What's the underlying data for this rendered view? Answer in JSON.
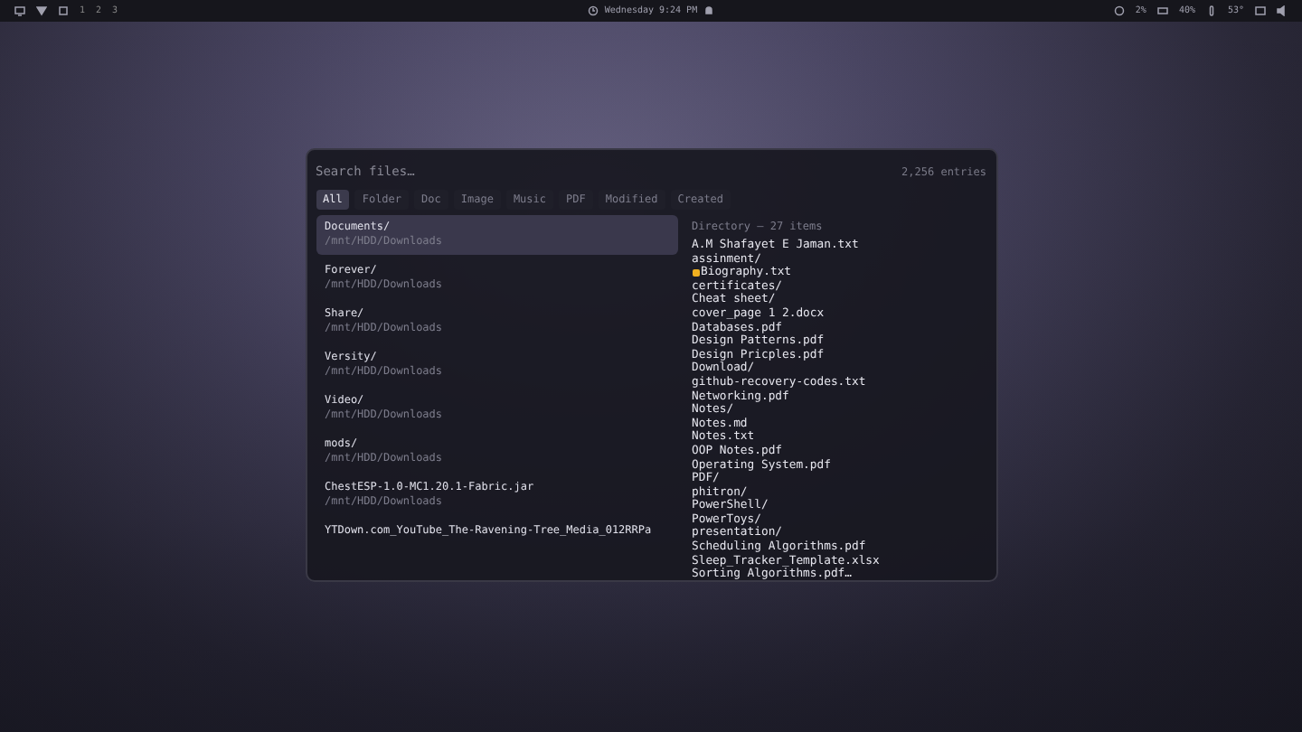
{
  "top_bar": {
    "workspaces": [
      {
        "label": "1",
        "selected": false
      },
      {
        "label": "2",
        "selected": false
      },
      {
        "label": "3",
        "selected": false
      }
    ],
    "clock": "Wednesday 9:24 PM",
    "status": [
      {
        "kind": "cpu",
        "text": "2%"
      },
      {
        "kind": "memory",
        "text": "40%"
      },
      {
        "kind": "temperature",
        "text": "53°"
      }
    ]
  },
  "launcher": {
    "search": {
      "placeholder": "Search files…"
    },
    "count": "2,256 entries",
    "filters": [
      {
        "label": "All",
        "selected": true
      },
      {
        "label": "Folder",
        "selected": false
      },
      {
        "label": "Doc",
        "selected": false
      },
      {
        "label": "Image",
        "selected": false
      },
      {
        "label": "Music",
        "selected": false
      },
      {
        "label": "PDF",
        "selected": false
      },
      {
        "label": "Modified",
        "selected": false
      },
      {
        "label": "Created",
        "selected": false
      }
    ],
    "results": [
      {
        "name": "Documents/",
        "path": "/mnt/HDD/Downloads",
        "selected": true
      },
      {
        "name": "Forever/",
        "path": "/mnt/HDD/Downloads",
        "selected": false
      },
      {
        "name": "Share/",
        "path": "/mnt/HDD/Downloads",
        "selected": false
      },
      {
        "name": "Versity/",
        "path": "/mnt/HDD/Downloads",
        "selected": false
      },
      {
        "name": "Video/",
        "path": "/mnt/HDD/Downloads",
        "selected": false
      },
      {
        "name": "mods/",
        "path": "/mnt/HDD/Downloads",
        "selected": false
      },
      {
        "name": "ChestESP-1.0-MC1.20.1-Fabric.jar",
        "path": "/mnt/HDD/Downloads",
        "selected": false
      },
      {
        "name": "YTDown.com_YouTube_The-Ravening-Tree_Media_012RRPa",
        "selected": false
      }
    ],
    "preview": {
      "header": "Directory — 27 items",
      "entries": [
        {
          "name": "A.M Shafayet E Jaman.txt",
          "starred": false
        },
        {
          "name": "assinment/",
          "starred": false
        },
        {
          "name": "Biography.txt",
          "starred": true
        },
        {
          "name": "certificates/",
          "starred": false
        },
        {
          "name": "Cheat sheet/",
          "starred": false
        },
        {
          "name": "cover_page 1 2.docx",
          "starred": false
        },
        {
          "name": "Databases.pdf",
          "starred": false
        },
        {
          "name": "Design Patterns.pdf",
          "starred": false
        },
        {
          "name": "Design Pricples.pdf",
          "starred": false
        },
        {
          "name": "Download/",
          "starred": false
        },
        {
          "name": "github-recovery-codes.txt",
          "starred": false
        },
        {
          "name": "Networking.pdf",
          "starred": false
        },
        {
          "name": "Notes/",
          "starred": false
        },
        {
          "name": "Notes.md",
          "starred": false
        },
        {
          "name": "Notes.txt",
          "starred": false
        },
        {
          "name": "OOP Notes.pdf",
          "starred": false
        },
        {
          "name": "Operating System.pdf",
          "starred": false
        },
        {
          "name": "PDF/",
          "starred": false
        },
        {
          "name": "phitron/",
          "starred": false
        },
        {
          "name": "PowerShell/",
          "starred": false
        },
        {
          "name": "PowerToys/",
          "starred": false
        },
        {
          "name": "presentation/",
          "starred": false
        },
        {
          "name": "Scheduling Algorithms.pdf",
          "starred": false
        },
        {
          "name": "Sleep_Tracker_Template.xlsx",
          "starred": false
        },
        {
          "name": "Sorting Algorithms.pdf…",
          "starred": false
        }
      ]
    }
  }
}
